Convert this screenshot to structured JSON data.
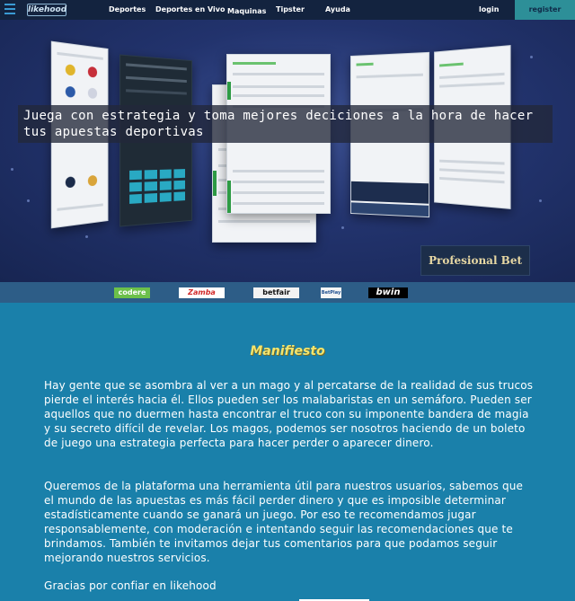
{
  "nav": {
    "logo": "likehood",
    "links": [
      "Deportes",
      "Deportes en Vivo",
      "Maquinas",
      "Tipster",
      "Ayuda"
    ],
    "login": "login",
    "register": "register"
  },
  "hero": {
    "tagline": "Juega con estrategia y toma mejores deciciones  a la hora de hacer  tus apuestas deportivas",
    "badge": "Profesional Bet"
  },
  "partners": [
    "codere",
    "Zamba",
    "betfair",
    "BetPlay",
    "bwin"
  ],
  "manifesto": {
    "title": "Manifiesto",
    "paragraph1": "Hay gente que se asombra al ver a un mago y al percatarse de la realidad de sus trucos pierde el interés hacia él. Ellos pueden ser los malabaristas en un semáforo. Pueden ser aquellos que no duermen hasta encontrar el truco con su imponente bandera de magia y su secreto difícil de revelar. Los magos, podemos ser nosotros haciendo de un boleto de juego una estrategia perfecta para hacer perder o aparecer dinero.",
    "paragraph2": "Queremos de la plataforma una herramienta útil para nuestros usuarios, sabemos que el mundo de las apuestas es más fácil perder dinero y que es imposible determinar estadísticamente cuando se ganará un juego. Por eso te recomendamos jugar responsablemente, con moderación e intentando seguir las recomendaciones que te brindamos. También te invitamos dejar tus comentarios para que podamos seguir mejorando nuestros servicios.",
    "thanks": "Gracias por confiar en likehood"
  }
}
